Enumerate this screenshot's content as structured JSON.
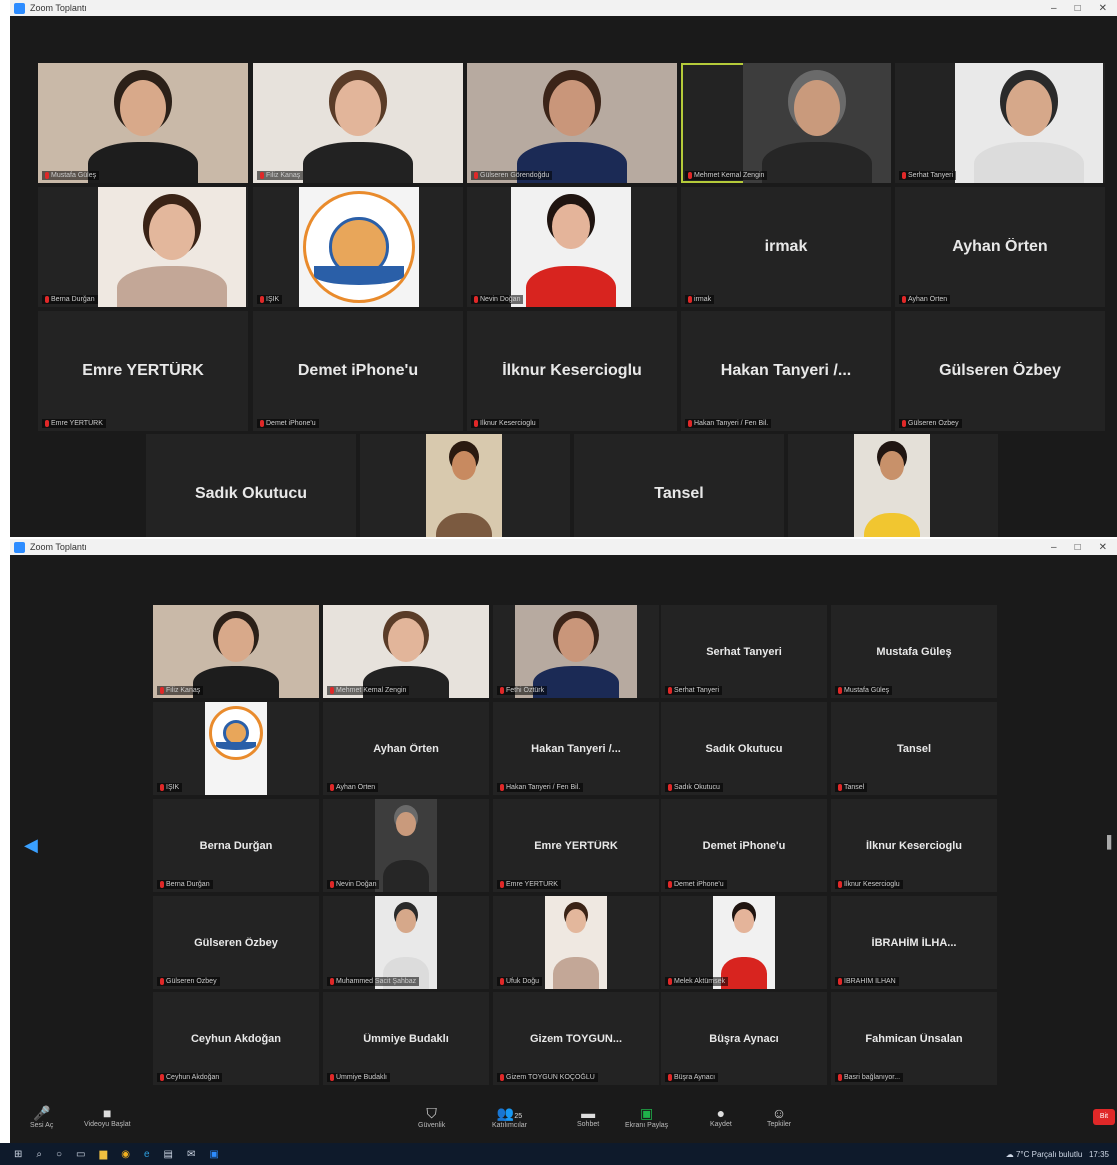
{
  "window_title": "Zoom Toplantı",
  "top_grid": {
    "rows": [
      [
        {
          "type": "video",
          "label": "Mustafa Güleş"
        },
        {
          "type": "video",
          "label": "Filiz Kanaş"
        },
        {
          "type": "video",
          "label": "Gülseren Görendoğdu"
        },
        {
          "type": "video",
          "label": "Mehmet Kemal Zengin",
          "speaking": true
        },
        {
          "type": "video",
          "label": "Serhat Tanyeri"
        }
      ],
      [
        {
          "type": "video",
          "label": "Berna Durğan"
        },
        {
          "type": "logo",
          "label": "IŞIK"
        },
        {
          "type": "video",
          "label": "Nevin Doğan"
        },
        {
          "type": "name",
          "name": "irmak",
          "label": "irmak"
        },
        {
          "type": "name",
          "name": "Ayhan Örten",
          "label": "Ayhan Örten"
        }
      ],
      [
        {
          "type": "name",
          "name": "Emre YERTÜRK",
          "label": "Emre YERTÜRK"
        },
        {
          "type": "name",
          "name": "Demet iPhone'u",
          "label": "Demet iPhone'u"
        },
        {
          "type": "name",
          "name": "İlknur Kesercioglu",
          "label": "İlknur Kesercioglu"
        },
        {
          "type": "name",
          "name": "Hakan Tanyeri /...",
          "label": "Hakan Tanyeri / Fen Bil."
        },
        {
          "type": "name",
          "name": "Gülseren Özbey",
          "label": "Gülseren Özbey"
        }
      ],
      [
        {
          "type": "name",
          "name": "Sadık Okutucu",
          "label": ""
        },
        {
          "type": "video",
          "label": ""
        },
        {
          "type": "name",
          "name": "Tansel",
          "label": ""
        },
        {
          "type": "video",
          "label": ""
        }
      ]
    ]
  },
  "bottom_grid": {
    "rows": [
      [
        {
          "type": "video",
          "label": "Filiz Kanaş",
          "speaking": true
        },
        {
          "type": "video",
          "label": "Mehmet Kemal Zengin"
        },
        {
          "type": "video",
          "label": "Fethi Öztürk"
        },
        {
          "type": "name",
          "name": "Serhat Tanyeri",
          "label": "Serhat Tanyeri"
        },
        {
          "type": "name",
          "name": "Mustafa Güleş",
          "label": "Mustafa Güleş"
        }
      ],
      [
        {
          "type": "logo",
          "label": "IŞIK"
        },
        {
          "type": "name",
          "name": "Ayhan Örten",
          "label": "Ayhan Örten"
        },
        {
          "type": "name",
          "name": "Hakan Tanyeri /...",
          "label": "Hakan Tanyeri / Fen Bil."
        },
        {
          "type": "name",
          "name": "Sadık Okutucu",
          "label": "Sadık Okutucu"
        },
        {
          "type": "name",
          "name": "Tansel",
          "label": "Tansel"
        }
      ],
      [
        {
          "type": "name",
          "name": "Berna Durğan",
          "label": "Berna Durğan"
        },
        {
          "type": "video",
          "label": "Nevin Doğan"
        },
        {
          "type": "name",
          "name": "Emre YERTÜRK",
          "label": "Emre YERTÜRK"
        },
        {
          "type": "name",
          "name": "Demet iPhone'u",
          "label": "Demet iPhone'u"
        },
        {
          "type": "name",
          "name": "İlknur Kesercioglu",
          "label": "İlknur Kesercioglu"
        }
      ],
      [
        {
          "type": "name",
          "name": "Gülseren Özbey",
          "label": "Gülseren Özbey"
        },
        {
          "type": "video",
          "label": "Muhammed Sacit Şahbaz"
        },
        {
          "type": "video",
          "label": "Ufuk Doğu"
        },
        {
          "type": "video",
          "label": "Melek Aktümsek"
        },
        {
          "type": "name",
          "name": "İBRAHİM İLHA...",
          "label": "İBRAHİM İLHAN"
        }
      ],
      [
        {
          "type": "name",
          "name": "Ceyhun Akdoğan",
          "label": "Ceyhun Akdoğan"
        },
        {
          "type": "name",
          "name": "Ümmiye Budaklı",
          "label": "Ümmiye Budaklı"
        },
        {
          "type": "name",
          "name": "Gizem TOYGUN...",
          "label": "Gizem TOYGUN KOÇOĞLU"
        },
        {
          "type": "name",
          "name": "Büşra Aynacı",
          "label": "Büşra Aynacı"
        },
        {
          "type": "name",
          "name": "Fahmican Ünsalan",
          "label": "Basri bağlanıyor..."
        }
      ]
    ]
  },
  "toolbar": {
    "mute": "Sesi Aç",
    "video": "Videoyu Başlat",
    "security": "Güvenlik",
    "participants": "Katılımcılar",
    "participants_count": "25",
    "chat": "Sohbet",
    "share": "Ekranı Paylaş",
    "record": "Kaydet",
    "reactions": "Tepkiler",
    "end": "Bit"
  },
  "taskbar": {
    "weather": "7°C Parçalı bulutlu",
    "clock": "17:35"
  },
  "colors": {
    "speaking_border": "#b5cb3a",
    "tile_bg": "#232323",
    "background": "#1a1a1a",
    "share_green": "#1fb14a",
    "end_red": "#e02828"
  }
}
